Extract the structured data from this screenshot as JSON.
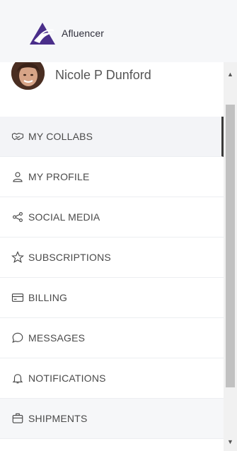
{
  "brand": {
    "name": "Afluencer",
    "logo_icon": "afluencer-logo-icon",
    "color": "#4a2e8a"
  },
  "user": {
    "name": "Nicole P Dunford",
    "avatar_icon": "user-avatar"
  },
  "nav": {
    "items": [
      {
        "label": "MY COLLABS",
        "icon": "handshake-icon",
        "active": true
      },
      {
        "label": "MY PROFILE",
        "icon": "user-icon"
      },
      {
        "label": "SOCIAL MEDIA",
        "icon": "share-icon"
      },
      {
        "label": "SUBSCRIPTIONS",
        "icon": "star-icon"
      },
      {
        "label": "BILLING",
        "icon": "credit-card-icon"
      },
      {
        "label": "MESSAGES",
        "icon": "chat-bubble-icon"
      },
      {
        "label": "NOTIFICATIONS",
        "icon": "bell-icon"
      },
      {
        "label": "SHIPMENTS",
        "icon": "box-icon",
        "hover": true
      }
    ]
  },
  "scrollbar": {
    "up_icon": "scroll-up-arrow-icon",
    "down_icon": "scroll-down-arrow-icon"
  }
}
